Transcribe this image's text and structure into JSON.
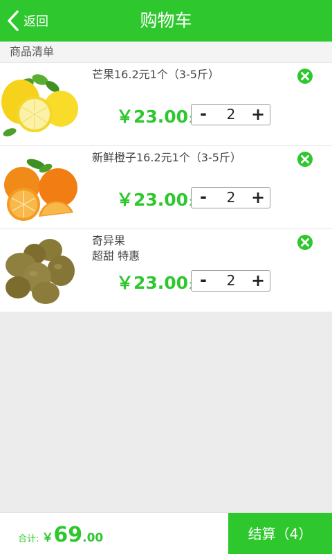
{
  "header": {
    "back_label": "返回",
    "title": "购物车"
  },
  "section_label": "商品清单",
  "items": [
    {
      "name": "芒果16.2元1个（3-5斤）",
      "price": "￥23.00",
      "x": "x",
      "minus": "-",
      "quantity": "2",
      "plus": "+",
      "image": "lemons-image"
    },
    {
      "name": "新鲜橙子16.2元1个（3-5斤）",
      "price": "￥23.00",
      "x": "x",
      "minus": "-",
      "quantity": "2",
      "plus": "+",
      "image": "oranges-image"
    },
    {
      "name": "奇异果",
      "subtitle": "超甜 特惠",
      "price": "￥23.00",
      "x": "x",
      "minus": "-",
      "quantity": "2",
      "plus": "+",
      "image": "kiwis-image"
    }
  ],
  "footer": {
    "total_label": "合计:",
    "currency": "￥",
    "total_int": "69",
    "total_dec": ".00",
    "checkout_label": "结算（4）"
  },
  "colors": {
    "accent": "#2ec82e",
    "remove": "#2ec82e"
  }
}
